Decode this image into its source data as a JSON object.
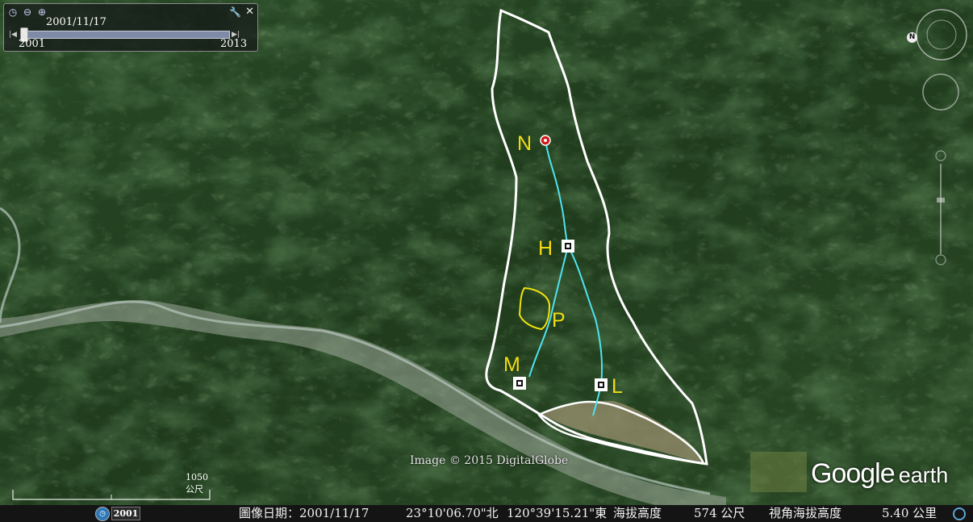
{
  "time_slider": {
    "current_date": "2001/11/17",
    "start_year": "2001",
    "end_year": "2013",
    "position_fraction": 0.0
  },
  "map": {
    "watermark": "Image © 2015 DigitalGlobe",
    "logo_google": "Google",
    "logo_earth": "earth",
    "scale_label": "1050 公尺",
    "outline_color": "#ffffff",
    "stream_color": "#4fe3f0",
    "polygon_color": "#f2e40c",
    "point_labels": [
      "N",
      "H",
      "P",
      "M",
      "L"
    ]
  },
  "status_bar": {
    "history_year": "2001",
    "imagery_date": "圖像日期：2001/11/17",
    "latitude": "23°10'06.70\"北",
    "longitude": "120°39'15.21\"東",
    "elevation_label": "海拔高度",
    "elevation_value": "574 公尺",
    "eye_alt_label": "視角海拔高度",
    "eye_alt_value": "5.40 公里"
  },
  "icons": {
    "clock": "clock-icon",
    "zoom_out": "zoom-out-icon",
    "zoom_in": "zoom-in-icon",
    "wrench": "wrench-icon",
    "close": "close-icon",
    "compass": "compass-icon",
    "history": "history-icon"
  }
}
